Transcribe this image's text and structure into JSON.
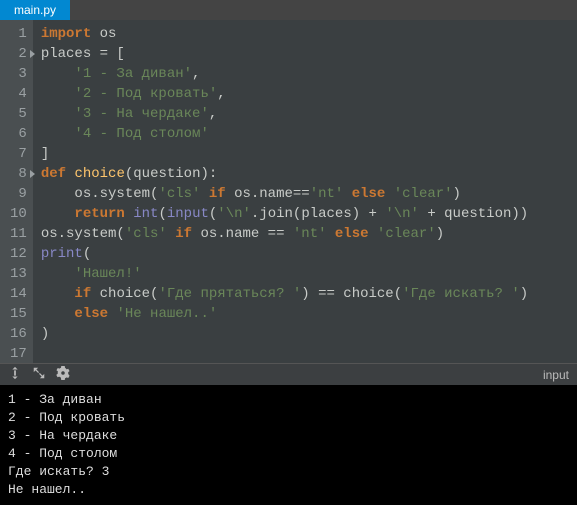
{
  "tabs": [
    {
      "label": "main.py"
    }
  ],
  "code": {
    "lines": [
      {
        "n": 1,
        "arrow": false,
        "tokens": [
          [
            "kw",
            "import"
          ],
          [
            "sp",
            " "
          ],
          [
            "id",
            "os"
          ]
        ]
      },
      {
        "n": 2,
        "arrow": true,
        "tokens": [
          [
            "id",
            "places "
          ],
          [
            "op",
            "= ["
          ]
        ]
      },
      {
        "n": 3,
        "arrow": false,
        "tokens": [
          [
            "sp",
            "    "
          ],
          [
            "str",
            "'1 - За диван'"
          ],
          [
            "op",
            ","
          ]
        ]
      },
      {
        "n": 4,
        "arrow": false,
        "tokens": [
          [
            "sp",
            "    "
          ],
          [
            "str",
            "'2 - Под кровать'"
          ],
          [
            "op",
            ","
          ]
        ]
      },
      {
        "n": 5,
        "arrow": false,
        "tokens": [
          [
            "sp",
            "    "
          ],
          [
            "str",
            "'3 - На чердаке'"
          ],
          [
            "op",
            ","
          ]
        ]
      },
      {
        "n": 6,
        "arrow": false,
        "tokens": [
          [
            "sp",
            "    "
          ],
          [
            "str",
            "'4 - Под столом'"
          ]
        ]
      },
      {
        "n": 7,
        "arrow": false,
        "tokens": [
          [
            "op",
            "]"
          ]
        ]
      },
      {
        "n": 8,
        "arrow": true,
        "tokens": [
          [
            "kw",
            "def"
          ],
          [
            "sp",
            " "
          ],
          [
            "fn",
            "choice"
          ],
          [
            "op",
            "("
          ],
          [
            "id",
            "question"
          ],
          [
            "op",
            "):"
          ]
        ]
      },
      {
        "n": 9,
        "arrow": false,
        "tokens": [
          [
            "sp",
            "    "
          ],
          [
            "id",
            "os.system("
          ],
          [
            "str",
            "'cls'"
          ],
          [
            "sp",
            " "
          ],
          [
            "kw",
            "if"
          ],
          [
            "sp",
            " "
          ],
          [
            "id",
            "os.name=="
          ],
          [
            "str",
            "'nt'"
          ],
          [
            "sp",
            " "
          ],
          [
            "kw",
            "else"
          ],
          [
            "sp",
            " "
          ],
          [
            "str",
            "'clear'"
          ],
          [
            "op",
            ")"
          ]
        ]
      },
      {
        "n": 10,
        "arrow": false,
        "tokens": [
          [
            "sp",
            "    "
          ],
          [
            "kw",
            "return"
          ],
          [
            "sp",
            " "
          ],
          [
            "bi",
            "int"
          ],
          [
            "op",
            "("
          ],
          [
            "bi",
            "input"
          ],
          [
            "op",
            "("
          ],
          [
            "str",
            "'\\n'"
          ],
          [
            "op",
            "."
          ],
          [
            "id",
            "join(places) + "
          ],
          [
            "str",
            "'\\n'"
          ],
          [
            "id",
            " + question))"
          ]
        ]
      },
      {
        "n": 11,
        "arrow": false,
        "tokens": [
          [
            "id",
            "os.system("
          ],
          [
            "str",
            "'cls'"
          ],
          [
            "sp",
            " "
          ],
          [
            "kw",
            "if"
          ],
          [
            "sp",
            " "
          ],
          [
            "id",
            "os.name == "
          ],
          [
            "str",
            "'nt'"
          ],
          [
            "sp",
            " "
          ],
          [
            "kw",
            "else"
          ],
          [
            "sp",
            " "
          ],
          [
            "str",
            "'clear'"
          ],
          [
            "op",
            ")"
          ]
        ]
      },
      {
        "n": 12,
        "arrow": false,
        "tokens": [
          [
            "bi",
            "print"
          ],
          [
            "op",
            "("
          ]
        ]
      },
      {
        "n": 13,
        "arrow": false,
        "tokens": [
          [
            "sp",
            "    "
          ],
          [
            "str",
            "'Нашел!'"
          ]
        ]
      },
      {
        "n": 14,
        "arrow": false,
        "tokens": [
          [
            "sp",
            "    "
          ],
          [
            "kw",
            "if"
          ],
          [
            "sp",
            " "
          ],
          [
            "id",
            "choice("
          ],
          [
            "str",
            "'Где прятаться? '"
          ],
          [
            "id",
            ") == choice("
          ],
          [
            "str",
            "'Где искать? '"
          ],
          [
            "id",
            ")"
          ]
        ]
      },
      {
        "n": 15,
        "arrow": false,
        "tokens": [
          [
            "sp",
            "    "
          ],
          [
            "kw",
            "else"
          ],
          [
            "sp",
            " "
          ],
          [
            "str",
            "'Не нашел..'"
          ]
        ]
      },
      {
        "n": 16,
        "arrow": false,
        "tokens": [
          [
            "op",
            ")"
          ]
        ]
      },
      {
        "n": 17,
        "arrow": false,
        "tokens": []
      }
    ]
  },
  "terminal": {
    "label": "input",
    "lines": [
      "1 - За диван",
      "2 - Под кровать",
      "3 - На чердаке",
      "4 - Под столом",
      "Где искать? 3",
      "Не нашел.."
    ]
  }
}
